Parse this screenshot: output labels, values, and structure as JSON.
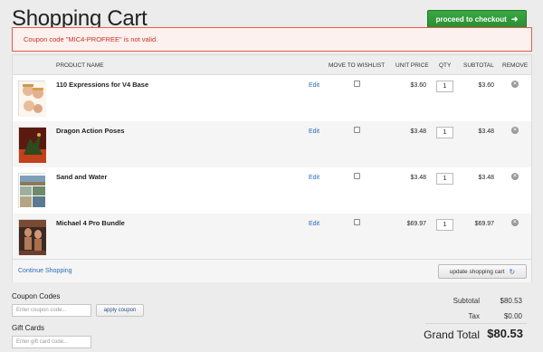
{
  "page": {
    "title": "Shopping Cart"
  },
  "checkout": {
    "label": "proceed to checkout",
    "icon": "arrow-right-icon"
  },
  "alert": {
    "message": "Coupon code \"MIC4-PROFREE\" is not valid."
  },
  "table": {
    "headers": {
      "product": "PRODUCT NAME",
      "wishlist": "MOVE TO WISHLIST",
      "unit_price": "UNIT PRICE",
      "qty": "QTY",
      "subtotal": "SUBTOTAL",
      "remove": "REMOVE"
    },
    "rows": [
      {
        "name": "110 Expressions for V4 Base",
        "edit": "Edit",
        "unit_price": "$3.60",
        "qty": "1",
        "subtotal": "$3.60",
        "thumb": "faces-thumbnail"
      },
      {
        "name": "Dragon Action Poses",
        "edit": "Edit",
        "unit_price": "$3.48",
        "qty": "1",
        "subtotal": "$3.48",
        "thumb": "dragon-thumbnail"
      },
      {
        "name": "Sand and Water",
        "edit": "Edit",
        "unit_price": "$3.48",
        "qty": "1",
        "subtotal": "$3.48",
        "thumb": "landscape-thumbnail"
      },
      {
        "name": "Michael 4 Pro Bundle",
        "edit": "Edit",
        "unit_price": "$69.97",
        "qty": "1",
        "subtotal": "$69.97",
        "thumb": "figure-thumbnail"
      }
    ]
  },
  "footer": {
    "continue_label": "Continue Shopping",
    "update_label": "update shopping cart",
    "update_icon": "refresh-icon"
  },
  "coupon": {
    "heading": "Coupon Codes",
    "placeholder": "Enter coupon code...",
    "apply_label": "apply coupon"
  },
  "gift": {
    "heading": "Gift Cards",
    "placeholder": "Enter gift card code..."
  },
  "totals": {
    "subtotal_label": "Subtotal",
    "subtotal": "$80.53",
    "tax_label": "Tax",
    "tax": "$0.00",
    "grand_label": "Grand Total",
    "grand": "$80.53"
  },
  "colors": {
    "accent_green": "#2e9b37",
    "error_red": "#c73224",
    "link_blue": "#2a6db5"
  }
}
